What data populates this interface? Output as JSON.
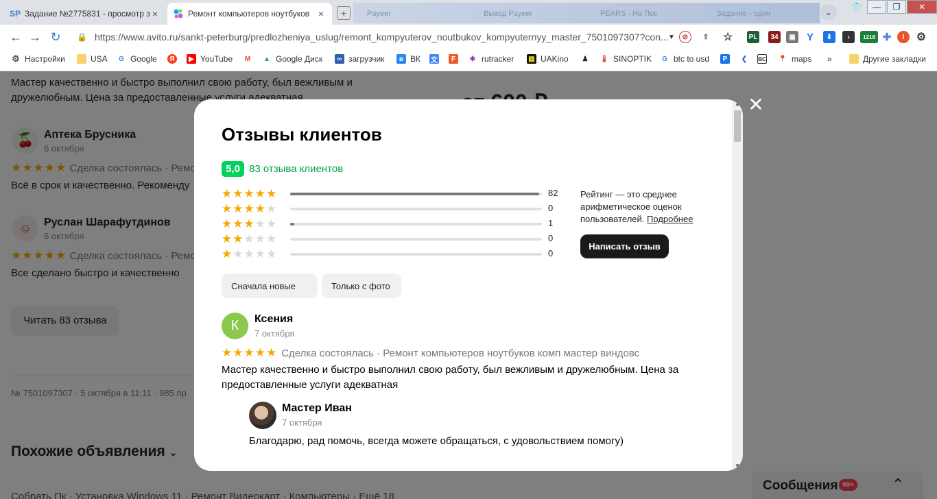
{
  "browser": {
    "tabs": [
      {
        "icon": "sp-icon",
        "icon_text": "SP",
        "title": "Задание №2775831 - просмотр з",
        "close": "×"
      },
      {
        "icon": "avito-icon",
        "title": "Ремонт компьютеров ноутбуков",
        "close": "×"
      }
    ],
    "ghost_tabs": [
      "Payeer",
      "Вывод Payeer",
      "PEARS - На Пос",
      "Задание - один"
    ],
    "new_tab": "+",
    "tab_menu": "⌄",
    "window": {
      "minimize": "—",
      "maximize": "❐",
      "close": "✕"
    },
    "back": "←",
    "forward": "→",
    "reload": "↻",
    "url": "https://www.avito.ru/sankt-peterburg/predlozheniya_uslug/remont_kompyuterov_noutbukov_kompyuternyy_master_7501097307?con...",
    "extensions": {
      "badge_34": "34",
      "badge_1218": "1218",
      "profile": "I",
      "pl": "PL"
    },
    "bookmarks": [
      {
        "label": "Настройки",
        "icon": "gear-icon"
      },
      {
        "label": "USA",
        "icon": "folder-icon"
      },
      {
        "label": "Google",
        "icon": "google-icon"
      },
      {
        "label": "",
        "icon": "yandex-icon"
      },
      {
        "label": "YouTube",
        "icon": "youtube-icon"
      },
      {
        "label": "",
        "icon": "gmail-icon"
      },
      {
        "label": "Google Диск",
        "icon": "drive-icon"
      },
      {
        "label": "загрузчик",
        "icon": "loader-icon"
      },
      {
        "label": "ВК",
        "icon": "vk-icon"
      },
      {
        "label": "",
        "icon": "translate-icon"
      },
      {
        "label": "",
        "icon": "f-icon"
      },
      {
        "label": "rutracker",
        "icon": "rutracker-icon"
      },
      {
        "label": "UAKino",
        "icon": "uakino-icon"
      },
      {
        "label": "",
        "icon": "figure-icon"
      },
      {
        "label": "SINOPTIK",
        "icon": "thermometer-icon"
      },
      {
        "label": "btc to usd",
        "icon": "google-icon"
      },
      {
        "label": "",
        "icon": "p-icon"
      },
      {
        "label": "",
        "icon": "arrow-icon"
      },
      {
        "label": "",
        "icon": "bc-icon"
      },
      {
        "label": "maps",
        "icon": "maps-icon"
      }
    ],
    "bookmarks_more": "»",
    "other_bookmarks": "Другие закладки"
  },
  "background": {
    "review_text_top_1": "Мастер качественно и быстро выполнил свою работу, был вежливым и",
    "review_text_top_2": "дружелюбным. Цена за предоставленные услуги адекватная",
    "price": "от 600 ₽",
    "reviews": [
      {
        "name": "Аптека Брусника",
        "date": "6 октября",
        "meta": "Сделка состоялась · Ремо",
        "text": "Всё в срок и качественно. Рекоменду"
      },
      {
        "name": "Руслан Шарафутдинов",
        "date": "6 октября",
        "meta": "Сделка состоялась · Ремо",
        "text": "Все сделано быстро и качественно"
      }
    ],
    "read_all_button": "Читать 83 отзыва",
    "listing_info": "№ 7501097307 · 5 октября в 11:11 · 985 пр",
    "similar_heading": "Похожие объявления",
    "similar_links": "Собрать Пк · Установка Windows 11 · Ремонт Видеокарт · Компьютеры · Ещё 18",
    "messages_label": "Сообщения",
    "messages_badge": "99+"
  },
  "modal": {
    "title": "Отзывы клиентов",
    "score": "5,0",
    "reviews_count": "83 отзыва клиентов",
    "rating_rows": [
      {
        "stars": 5,
        "count": "82",
        "fraction": 0.99
      },
      {
        "stars": 4,
        "count": "0",
        "fraction": 0
      },
      {
        "stars": 3,
        "count": "1",
        "fraction": 0.015
      },
      {
        "stars": 2,
        "count": "0",
        "fraction": 0
      },
      {
        "stars": 1,
        "count": "0",
        "fraction": 0
      }
    ],
    "rating_note": "Рейтинг — это среднее арифметическое оценок пользователей.",
    "rating_note_link": "Подробнее",
    "write_review_button": "Написать отзыв",
    "filters": [
      "Сначала новые",
      "Только с фото"
    ],
    "review": {
      "avatar_letter": "К",
      "name": "Ксения",
      "date": "7 октября",
      "stars": 5,
      "meta": "Сделка состоялась · Ремонт компьютеров ноутбуков комп мастер виндовс",
      "text": "Мастер качественно и быстро выполнил свою работу, был вежливым и дружелюбным. Цена за предоставленные услуги адекватная"
    },
    "answer": {
      "name": "Мастер Иван",
      "date": "7 октября",
      "text": "Благодарю, рад помочь, всегда можете обращаться, с удовольствием помогу)"
    },
    "close": "✕"
  },
  "colors": {
    "accent_green": "#02d15c",
    "link_green": "#00a046",
    "star": "#f4a800"
  }
}
